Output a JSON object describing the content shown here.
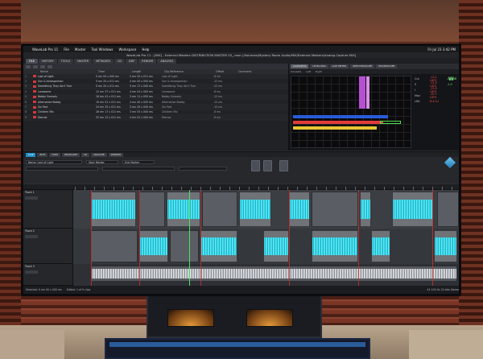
{
  "menubar": {
    "app": "WaveLab Pro 11",
    "items": [
      "File",
      "Master",
      "Tool Windows",
      "Workspace",
      "Help"
    ],
    "clock": "Fri Jul 23  3:42 PM"
  },
  "window": {
    "title": "WaveLab Pro 11 - [MIX] - External Masters DISTRIBUTION MASTER V2_.mon (/Volumes/Mystery Room Audio/MIX/External Masters/Analog Capture MIX]"
  },
  "tabs": [
    "FILE",
    "HISTORY",
    "TOOLS",
    "MASTER",
    "METADATA",
    "CD",
    "DDP",
    "RENDER",
    "ANALYSIS"
  ],
  "markers": {
    "columns": [
      "Name",
      "Time",
      "Length",
      "Clip Reference",
      "Offset",
      "Comment"
    ],
    "rows": [
      {
        "num": "1",
        "name": "Lost of Light",
        "time": "0 mn 00 s 000 ms",
        "len": "5 mn 20 s 011 ms",
        "ref": "Lost of Light",
        "off": "-8 ms"
      },
      {
        "num": "2",
        "name": "Sun & Introspection",
        "time": "5 mn 20 s 011 ms",
        "len": "4 mn 00 s 000 ms",
        "ref": "Sun & Introspection",
        "off": "-12 ms"
      },
      {
        "num": "3",
        "name": "Something They Ain't True",
        "time": "9 mn 20 s 011 ms",
        "len": "3 mn 17 s 000 ms",
        "ref": "Something They Ain't True",
        "off": "-22 ms"
      },
      {
        "num": "4",
        "name": "Lonesome",
        "time": "12 mn 37 s 011 ms",
        "len": "4 mn 04 s 000 ms",
        "ref": "Lonesome",
        "off": "-6 ms"
      },
      {
        "num": "5",
        "name": "Bobby Sumody",
        "time": "16 mn 41 s 011 ms",
        "len": "3 mn 11 s 000 ms",
        "ref": "Bobby Sumody",
        "off": "-12 ms"
      },
      {
        "num": "6",
        "name": "Alternative Bobby",
        "time": "19 mn 52 s 011 ms",
        "len": "4 mn 40 s 000 ms",
        "ref": "Alternative Bobby",
        "off": "-10 ms"
      },
      {
        "num": "7",
        "name": "Sin Part",
        "time": "24 mn 32 s 011 ms",
        "len": "3 mn 45 s 000 ms",
        "ref": "Sin Part",
        "off": "-10 ms"
      },
      {
        "num": "8",
        "name": "Children Mix",
        "time": "28 mn 17 s 011 ms",
        "len": "3 mn 55 s 000 ms",
        "ref": "Children Mix",
        "off": "-6 ms"
      },
      {
        "num": "9",
        "name": "Eternal",
        "time": "32 mn 12 s 011 ms",
        "len": "4 mn 02 s 000 ms",
        "ref": "Eternal",
        "off": "-6 ms"
      }
    ]
  },
  "meters": {
    "tabs": [
      "LOUDNESS",
      "LEVEL/PAN",
      "LIVE METER",
      "SPECTROSCOPE",
      "PHASESCOPE"
    ],
    "sub": [
      "Simulate",
      "Left",
      "Right"
    ],
    "readouts": [
      {
        "label": "Cut",
        "v1": "-13.1 LUFS",
        "v2": "-0.9 dB"
      },
      {
        "label": "S",
        "v1": "-11.5 LUFS",
        "v2": "-1.0"
      },
      {
        "label": "I",
        "v1": "-13.5 LUFS",
        "v2": ""
      },
      {
        "label": "Max",
        "v1": "-10.7 LUFS",
        "v2": ""
      },
      {
        "label": "LRA",
        "v1": "6.4 LU",
        "v2": ""
      }
    ],
    "logo": "W"
  },
  "clipinfo": {
    "tabs": [
      "CLIP",
      "EDIT",
      "FADE",
      "ENVELOPE",
      "CD",
      "ANALYZE",
      "RENDER"
    ],
    "fields": [
      "Name: Lost of Light",
      "Start Marker",
      "End Marker"
    ]
  },
  "tracks": [
    {
      "name": "Track 1"
    },
    {
      "name": "Track 2"
    },
    {
      "name": "Track 3"
    }
  ],
  "status": {
    "left": "Selected: 0 mn 00 s 000 ms",
    "mid": "Edited: 1 of 9 clips",
    "right": "44 100 Hz  24 bits  Stereo"
  }
}
